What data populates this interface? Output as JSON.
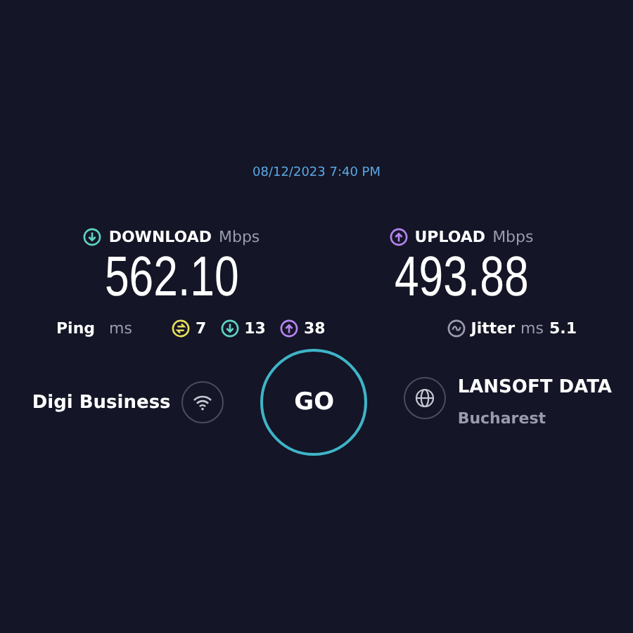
{
  "timestamp": "08/12/2023 7:40 PM",
  "results": [
    {
      "kind": "download",
      "label": "DOWNLOAD",
      "unit": "Mbps",
      "value": "562.10",
      "color": "#5ed3c3"
    },
    {
      "kind": "upload",
      "label": "UPLOAD",
      "unit": "Mbps",
      "value": "493.88",
      "color": "#b584f0"
    }
  ],
  "ping": {
    "label": "Ping",
    "unit": "ms",
    "readings": [
      {
        "kind": "idle",
        "value": "7",
        "color": "#e8e05a"
      },
      {
        "kind": "download",
        "value": "13",
        "color": "#5ed3c3"
      },
      {
        "kind": "upload",
        "value": "38",
        "color": "#b584f0"
      }
    ]
  },
  "jitter": {
    "label": "Jitter",
    "unit": "ms",
    "value": "5.1"
  },
  "provider": {
    "name": "Digi Business"
  },
  "go_button": "GO",
  "server": {
    "name": "LANSOFT DATA",
    "location": "Bucharest"
  }
}
